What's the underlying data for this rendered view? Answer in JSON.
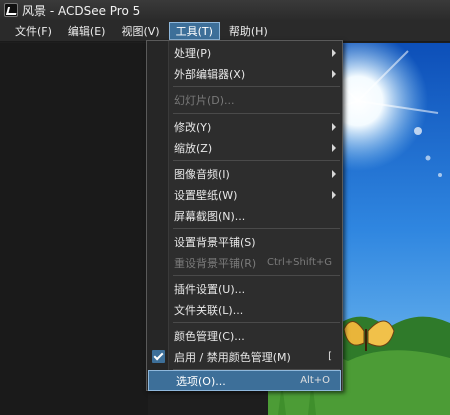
{
  "window": {
    "title": "风景 - ACDSee Pro 5"
  },
  "menubar": {
    "items": [
      "文件(F)",
      "编辑(E)",
      "视图(V)",
      "工具(T)",
      "帮助(H)"
    ],
    "active": "工具(T)"
  },
  "tools_menu": {
    "items": [
      {
        "label": "处理(P)",
        "submenu": true
      },
      {
        "label": "外部编辑器(X)",
        "submenu": true
      },
      {
        "label": "幻灯片(D)...",
        "disabled": true
      },
      {
        "label": "修改(Y)",
        "submenu": true
      },
      {
        "label": "缩放(Z)",
        "submenu": true
      },
      {
        "label": "图像音频(I)",
        "submenu": true
      },
      {
        "label": "设置壁纸(W)",
        "submenu": true
      },
      {
        "label": "屏幕截图(N)..."
      },
      {
        "label": "设置背景平铺(S)"
      },
      {
        "label": "重设背景平铺(R)",
        "shortcut": "Ctrl+Shift+G",
        "disabled": true
      },
      {
        "label": "插件设置(U)..."
      },
      {
        "label": "文件关联(L)..."
      },
      {
        "label": "颜色管理(C)..."
      },
      {
        "label": "启用 / 禁用颜色管理(M)",
        "shortcut": "[",
        "checked": true
      },
      {
        "label": "选项(O)...",
        "shortcut": "Alt+O",
        "highlighted": true
      }
    ]
  },
  "colors": {
    "highlight": "#3d6f99",
    "menu_bg": "#2d2d2d",
    "app_bg": "#1e1e1e"
  },
  "icons": [
    "app-icon",
    "submenu-arrow-icon",
    "check-icon"
  ]
}
